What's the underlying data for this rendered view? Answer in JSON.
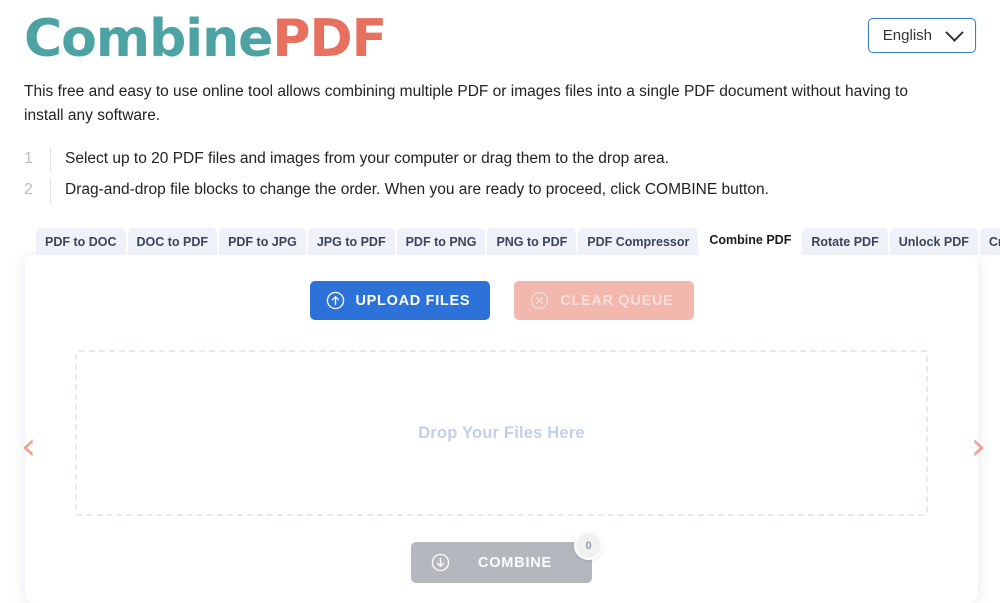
{
  "header": {
    "logo_part1": "Combine",
    "logo_part2": "PDF",
    "logo_color_1": "#4da3a3",
    "logo_color_2": "#e8705f",
    "language": "English",
    "language_icon": "chevron-down-icon"
  },
  "intro": {
    "text": "This free and easy to use online tool allows combining multiple PDF or images files into a single PDF document without having to install any software."
  },
  "steps": [
    {
      "num": "1",
      "text": "Select up to 20 PDF files and images from your computer or drag them to the drop area."
    },
    {
      "num": "2",
      "text": "Drag-and-drop file blocks to change the order. When you are ready to proceed, click COMBINE button."
    }
  ],
  "tabs": [
    {
      "label": "PDF to DOC",
      "active": false
    },
    {
      "label": "DOC to PDF",
      "active": false
    },
    {
      "label": "PDF to JPG",
      "active": false
    },
    {
      "label": "JPG to PDF",
      "active": false
    },
    {
      "label": "PDF to PNG",
      "active": false
    },
    {
      "label": "PNG to PDF",
      "active": false
    },
    {
      "label": "PDF Compressor",
      "active": false
    },
    {
      "label": "Combine PDF",
      "active": true
    },
    {
      "label": "Rotate PDF",
      "active": false
    },
    {
      "label": "Unlock PDF",
      "active": false
    },
    {
      "label": "Crop PDF",
      "active": false
    }
  ],
  "main": {
    "upload_button": {
      "label": "UPLOAD FILES",
      "icon": "upload-circle-icon",
      "color": "#2d72d9"
    },
    "clear_button": {
      "label": "CLEAR QUEUE",
      "icon": "close-circle-icon",
      "color": "#f2b8ae"
    },
    "dropzone": {
      "text": "Drop Your Files Here"
    },
    "prev_arrow": "‹",
    "next_arrow": "›",
    "combine_button": {
      "label": "COMBINE",
      "icon": "download-circle-icon",
      "badge_count": "0",
      "color": "#b4b7bd"
    }
  }
}
